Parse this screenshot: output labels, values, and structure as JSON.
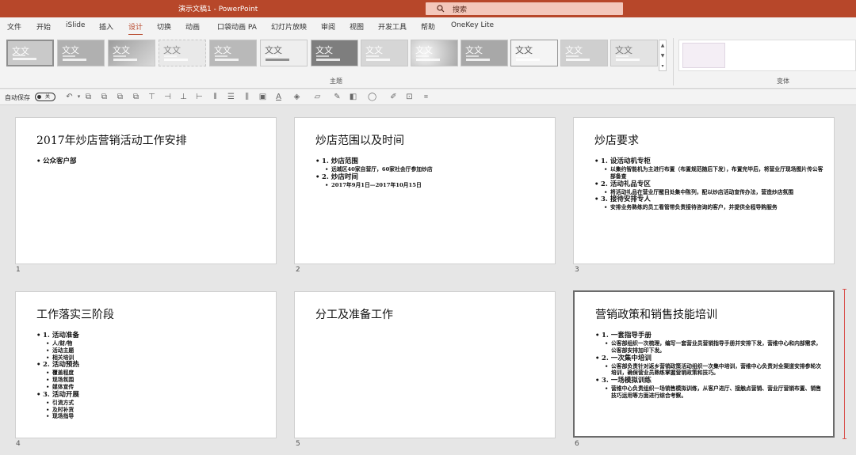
{
  "titlebar": {
    "title": "演示文稿1  -  PowerPoint",
    "search_placeholder": "搜索"
  },
  "menu": {
    "tabs": [
      "文件",
      "开始",
      "iSlide",
      "插入",
      "设计",
      "切换",
      "动画",
      "口袋动画 PA",
      "幻灯片放映",
      "审阅",
      "视图",
      "开发工具",
      "帮助",
      "OneKey Lite"
    ],
    "active": "设计"
  },
  "ribbon": {
    "theme_sample_text": "文文",
    "themes_group_label": "主题",
    "variants_group_label": "变体"
  },
  "qat": {
    "autosave_label": "自动保存",
    "autosave_state": "关"
  },
  "slides": [
    {
      "number": "1",
      "title": "2017年炒店营销活动工作安排",
      "bullets": [
        {
          "level": 1,
          "text": "公众客户部"
        }
      ]
    },
    {
      "number": "2",
      "title": "炒店范围以及时间",
      "bullets": [
        {
          "level": 1,
          "text": "1. 炒店范围"
        },
        {
          "level": 2,
          "text": "远城区40家自营厅，60家社会厅参加炒店"
        },
        {
          "level": 1,
          "text": "2. 炒店时间"
        },
        {
          "level": 2,
          "text": "2017年9月1日—2017年10月15日"
        }
      ]
    },
    {
      "number": "3",
      "title": "炒店要求",
      "bullets": [
        {
          "level": 1,
          "text": "1. 设活动机专柜"
        },
        {
          "level": 2,
          "text": "以集约智能机为主进行布置（布置规范随后下发），布置完毕后，将营业厅现场图片传公客部备查"
        },
        {
          "level": 1,
          "text": "2. 活动礼品专区"
        },
        {
          "level": 2,
          "text": "将活动礼品在营业厅醒目处集中陈列，配以炒店活动宣传办法，营造炒店氛围"
        },
        {
          "level": 1,
          "text": "3. 接待安排专人"
        },
        {
          "level": 2,
          "text": "安排业务熟练的员工看管带负责接待咨询的客户，并提供全程导购服务"
        }
      ]
    },
    {
      "number": "4",
      "title": "工作落实三阶段",
      "bullets": [
        {
          "level": 1,
          "text": "1. 活动准备"
        },
        {
          "level": 2,
          "text": "人/财/物"
        },
        {
          "level": 2,
          "text": "活动主题"
        },
        {
          "level": 2,
          "text": "相关培训"
        },
        {
          "level": 1,
          "text": "2. 活动预热"
        },
        {
          "level": 2,
          "text": "覆盖程度"
        },
        {
          "level": 2,
          "text": "现场氛围"
        },
        {
          "level": 2,
          "text": "媒体宣传"
        },
        {
          "level": 1,
          "text": "3. 活动开展"
        },
        {
          "level": 2,
          "text": "引流方式"
        },
        {
          "level": 2,
          "text": "及时补货"
        },
        {
          "level": 2,
          "text": "现场指导"
        }
      ]
    },
    {
      "number": "5",
      "title": "分工及准备工作",
      "bullets": []
    },
    {
      "number": "6",
      "title": "营销政策和销售技能培训",
      "bullets": [
        {
          "level": 1,
          "text": "1. 一套指导手册"
        },
        {
          "level": 2,
          "text": "公客部组织一次梳理，编写一套营业员营销指导手册并安排下发，营维中心和内部需求，公客部安排加印下发。"
        },
        {
          "level": 1,
          "text": "2. 一次集中培训"
        },
        {
          "level": 2,
          "text": "公客部负责针对返乡营销政策活动组织一次集中培训，营维中心负责对全渠道安排参轮次培训，确保营业员熟练掌握营销政策和技巧。"
        },
        {
          "level": 1,
          "text": "3. 一场模拟训练"
        },
        {
          "level": 2,
          "text": "营维中心负责组织一场销售模拟训练，从客户进厅、接触点营销、营业厅营销布置、销售技巧运用等方面进行综合考察。"
        }
      ]
    }
  ],
  "colors": {
    "accent": "#b7472a",
    "background": "#e6e6e6"
  }
}
